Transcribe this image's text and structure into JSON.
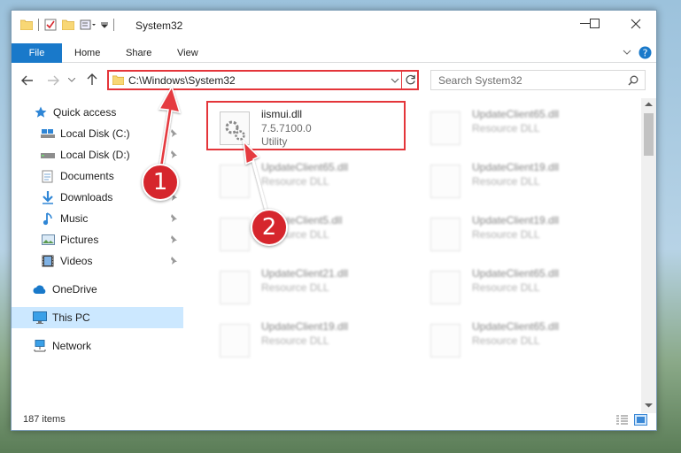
{
  "window": {
    "title": "System32",
    "controls": {
      "minimize": "minimize",
      "maximize": "maximize",
      "close": "close"
    }
  },
  "ribbon": {
    "tabs": [
      "File",
      "Home",
      "Share",
      "View"
    ]
  },
  "address": {
    "path": "C:\\Windows\\System32",
    "search_placeholder": "Search System32"
  },
  "nav": {
    "items": [
      {
        "label": "Quick access",
        "icon": "star-icon",
        "pinned": false
      },
      {
        "label": "Local Disk (C:)",
        "icon": "drive-icon",
        "pinned": true
      },
      {
        "label": "Local Disk (D:)",
        "icon": "drive-icon",
        "pinned": true
      },
      {
        "label": "Documents",
        "icon": "documents-icon",
        "pinned": true
      },
      {
        "label": "Downloads",
        "icon": "download-icon",
        "pinned": true
      },
      {
        "label": "Music",
        "icon": "music-icon",
        "pinned": true
      },
      {
        "label": "Pictures",
        "icon": "pictures-icon",
        "pinned": true
      },
      {
        "label": "Videos",
        "icon": "videos-icon",
        "pinned": true
      },
      {
        "label": "OneDrive",
        "icon": "cloud-icon",
        "pinned": false
      },
      {
        "label": "This PC",
        "icon": "computer-icon",
        "pinned": false,
        "selected": true
      },
      {
        "label": "Network",
        "icon": "network-icon",
        "pinned": false
      }
    ]
  },
  "files": [
    {
      "name": "iismui.dll",
      "line1": "7.5.7100.0",
      "line2": "Utility",
      "highlighted": true
    },
    {
      "name": "UpdateClient65.dll",
      "line1": "Resource DLL"
    },
    {
      "name": "UpdateClient65.dll",
      "line1": "Resource DLL"
    },
    {
      "name": "UpdateClient19.dll",
      "line1": "Resource DLL"
    },
    {
      "name": "UpdateClient5.dll",
      "line1": "Resource DLL"
    },
    {
      "name": "UpdateClient19.dll",
      "line1": "Resource DLL"
    },
    {
      "name": "UpdateClient21.dll",
      "line1": "Resource DLL"
    },
    {
      "name": "UpdateClient65.dll",
      "line1": "Resource DLL"
    },
    {
      "name": "UpdateClient19.dll",
      "line1": "Resource DLL"
    },
    {
      "name": "UpdateClient65.dll",
      "line1": "Resource DLL"
    }
  ],
  "status": {
    "count": "187 items"
  },
  "annotations": {
    "step1": "1",
    "step2": "2"
  },
  "colors": {
    "accent": "#1979ca",
    "highlight": "#e4353a",
    "badge": "#d6262d",
    "selected": "#cce8ff"
  }
}
